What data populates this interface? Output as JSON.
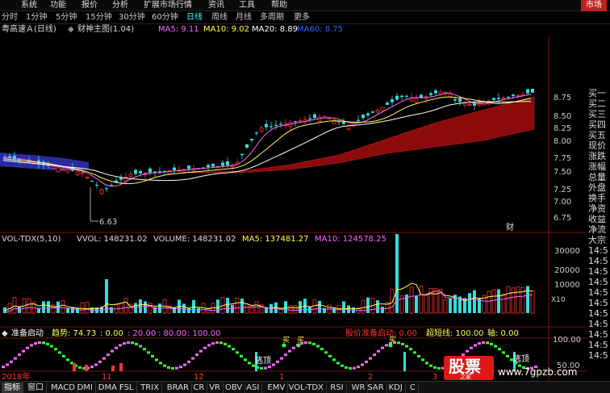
{
  "menubar": {
    "items": [
      "系统",
      "功能",
      "报价",
      "分析",
      "扩展市场行情",
      "资讯",
      "工具",
      "帮助"
    ],
    "market_label": "市场"
  },
  "periodbar": {
    "items": [
      "分时",
      "1分钟",
      "5分钟",
      "15分钟",
      "30分钟",
      "60分钟",
      "日线",
      "周线",
      "月线",
      "多周期",
      "更多"
    ],
    "active": "日线"
  },
  "main_chart": {
    "stock_name": "粤高速Ａ(日线)",
    "indicator_name": "财神主图(1.04)",
    "ma": [
      {
        "label": "MA5: 9.11",
        "color": "#ff66ff"
      },
      {
        "label": "MA10: 9.02",
        "color": "#ffff55"
      },
      {
        "label": "MA20: 8.89",
        "color": "#ffffff"
      },
      {
        "label": "MA60: 8.75",
        "color": "#3366ff"
      }
    ],
    "price_ticks": [
      "8.75",
      "8.50",
      "8.25",
      "8.00",
      "7.75",
      "7.50",
      "7.25",
      "7.00",
      "6.75"
    ],
    "low_label": "6.63",
    "cai_label": "财"
  },
  "volume_chart": {
    "title": "VOL-TDX(5,10)",
    "vvol": "VVOL: 148231.02",
    "volume": "VOLUME: 148231.02",
    "ma5": "MA5: 137481.27",
    "ma10": "MA10: 124578.25",
    "ticks": [
      "30000",
      "20000",
      "10000"
    ],
    "unit": "X10"
  },
  "sub_chart": {
    "title": "准备启动",
    "trend": "趋势: 74.73",
    "v0": ": 0.00",
    "v20": ": 20.00",
    "v80": ": 80.00",
    "v100": ": 100.00",
    "stock_prep": "股价准备启动: 0.00",
    "super_short": "超短线: 100.00",
    "axis": "轴: 0.00",
    "ticks": [
      "100.00",
      "50.00"
    ],
    "label_top": "逃顶",
    "label_buy": "买"
  },
  "date_axis": [
    "2018年",
    "11",
    "12",
    "1",
    "2",
    "3"
  ],
  "right_panel": [
    "买一",
    "买二",
    "买三",
    "买四",
    "买五",
    "现价",
    "涨跌",
    "涨幅",
    "总量",
    "外盘",
    "换手",
    "净资",
    "收益",
    "净流",
    "大宗",
    "14:5",
    "14:5",
    "14:5",
    "14:5",
    "14:5",
    "14:5",
    "14:5",
    "14:5",
    "14:5",
    "14:5",
    "14:5"
  ],
  "tabs": [
    "指标",
    "窗口",
    "MACD",
    "DMI",
    "DMA",
    "FSL",
    "TRIX",
    "BRAR",
    "CR",
    "VR",
    "OBV",
    "ASI",
    "EMV",
    "VOL-TDX",
    "RSI",
    "WR",
    "SAR",
    "KDJ",
    "C"
  ],
  "watermark": {
    "logo_text": "股票",
    "sub_text": "之家",
    "url": "www.7gpzb.com"
  },
  "colors": {
    "up": "#ff3333",
    "down": "#33dddd",
    "grid_red": "#7a1010",
    "accent": "#3ff"
  }
}
